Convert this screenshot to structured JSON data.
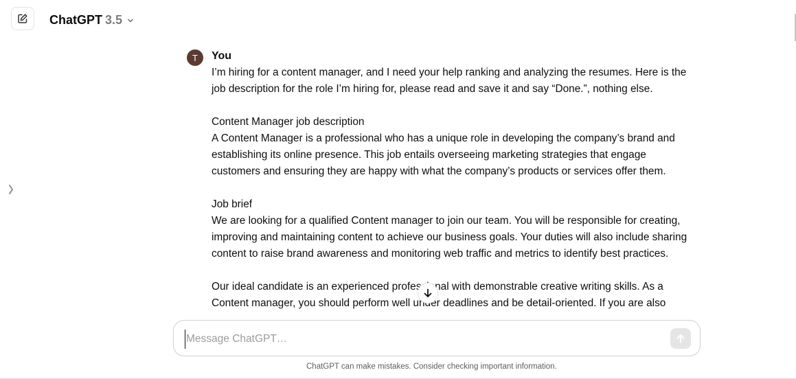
{
  "header": {
    "model_name": "ChatGPT",
    "model_version": "3.5"
  },
  "conversation": {
    "avatar_initial": "T",
    "author": "You",
    "paragraphs": [
      "I’m hiring for a content manager, and I need your help ranking and analyzing the resumes. Here is the job description for the role I’m hiring for, please read and save it and say “Done.”, nothing else.",
      "",
      "Content Manager job description",
      "A Content Manager is a professional who has a unique role in developing the company’s brand and establishing its online presence. This job entails overseeing marketing strategies that engage customers and ensuring they are happy with what the company’s products or services offer them.",
      "",
      "Job brief",
      "We are looking for a qualified Content manager to join our team. You will be responsible for creating, improving and maintaining content to achieve our business goals. Your duties will also include sharing content to raise brand awareness and monitoring web traffic and metrics to identify best practices.",
      "",
      "Our ideal candidate is an experienced professional with demonstrable creative writing skills. As a Content manager, you should perform well under deadlines and be detail-oriented. If you are also"
    ]
  },
  "composer": {
    "placeholder": "Message ChatGPT…",
    "value": ""
  },
  "footer": {
    "disclaimer": "ChatGPT can make mistakes. Consider checking important information."
  },
  "icons": {
    "new_chat": "edit-icon",
    "model_chevron": "chevron-down-icon",
    "sidebar_toggle": "chevron-right-icon",
    "scroll_down": "arrow-down-icon",
    "send": "arrow-up-icon"
  },
  "colors": {
    "avatar_bg": "#5b3a31",
    "text": "#0d0d0d",
    "muted": "#7d7d7d",
    "send_bg": "#e5e5e5"
  }
}
